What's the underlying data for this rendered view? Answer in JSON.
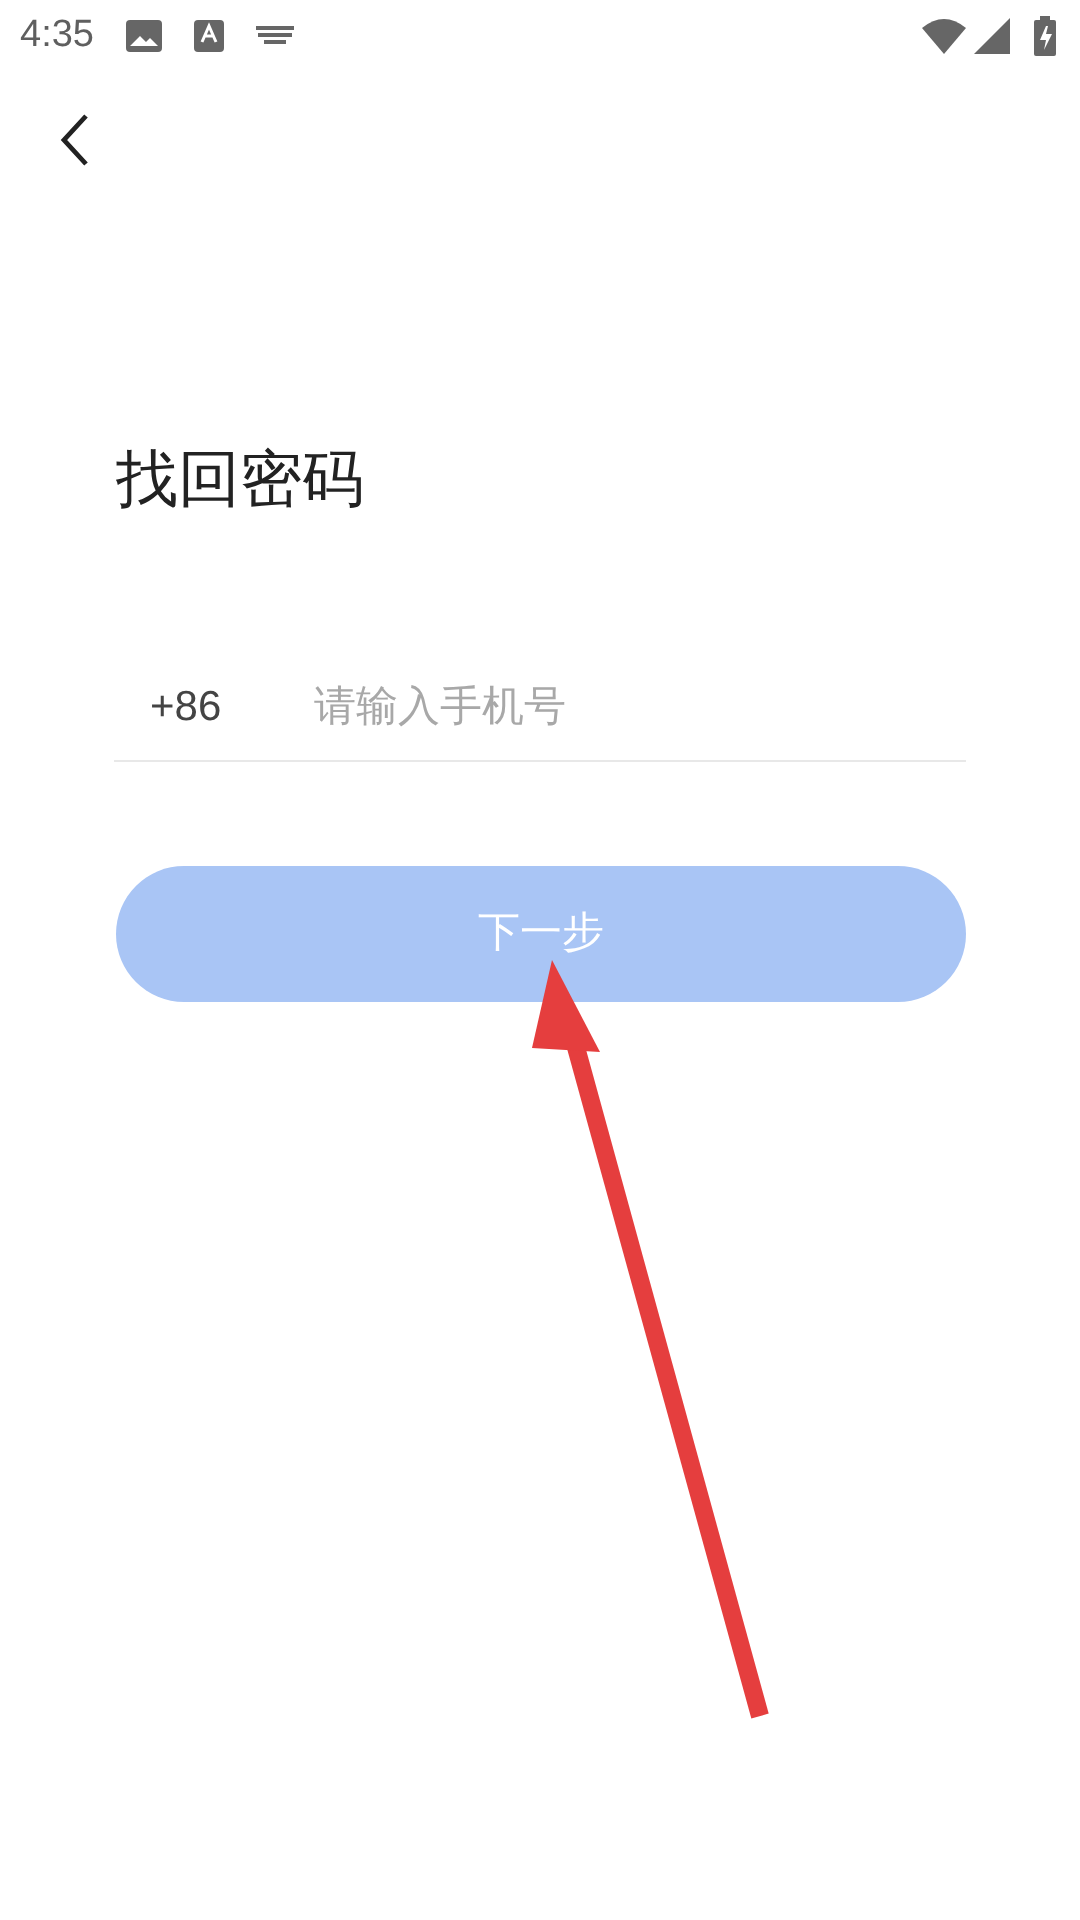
{
  "status_bar": {
    "time": "4:35"
  },
  "title": "找回密码",
  "phone": {
    "country_code": "+86",
    "placeholder": "请输入手机号"
  },
  "next_button": {
    "label": "下一步",
    "disabled": true
  }
}
